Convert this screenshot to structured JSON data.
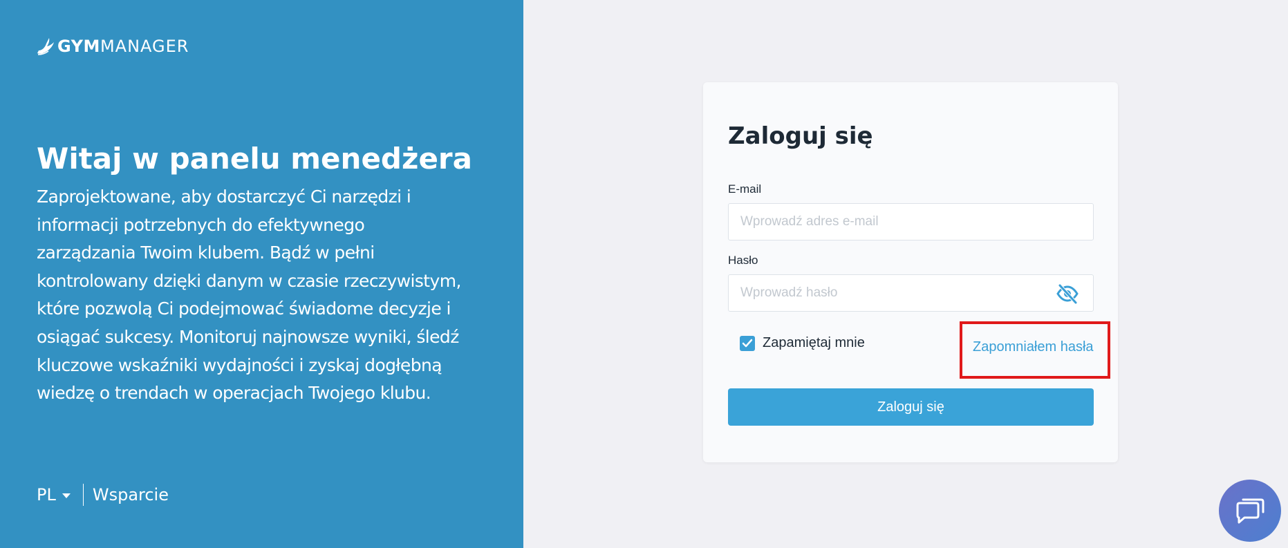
{
  "brand": {
    "name_bold": "GYM",
    "name_light": "MANAGER",
    "primary_color": "#3391c2",
    "accent_color": "#3aa3d8",
    "highlight_color": "#e0191a"
  },
  "intro": {
    "title": "Witaj w panelu menedżera",
    "text": "Zaprojektowane, aby dostarczyć Ci narzędzi i informacji potrzebnych do efektywnego zarządzania Twoim klubem. Bądź w pełni kontrolowany dzięki danym w czasie rzeczywistym, które pozwolą Ci podejmować świadome decyzje i osiągać sukcesy. Monitoruj najnowsze wyniki, śledź kluczowe wskaźniki wydajności i zyskaj dogłębną wiedzę o trendach w operacjach Twojego klubu."
  },
  "footer": {
    "language": "PL",
    "support_label": "Wsparcie"
  },
  "login": {
    "title": "Zaloguj się",
    "email_label": "E-mail",
    "email_placeholder": "Wprowadź adres e-mail",
    "email_value": "",
    "password_label": "Hasło",
    "password_placeholder": "Wprowadź hasło",
    "password_value": "",
    "remember_label": "Zapamiętaj mnie",
    "remember_checked": true,
    "forgot_label": "Zapomniałem hasła",
    "submit_label": "Zaloguj się"
  },
  "icons": {
    "logo": "gym-manager-logo-icon",
    "password_toggle": "eye-slash-icon",
    "checkbox": "checkmark-icon",
    "chat": "chat-bubbles-icon",
    "language_caret": "caret-down-icon"
  }
}
